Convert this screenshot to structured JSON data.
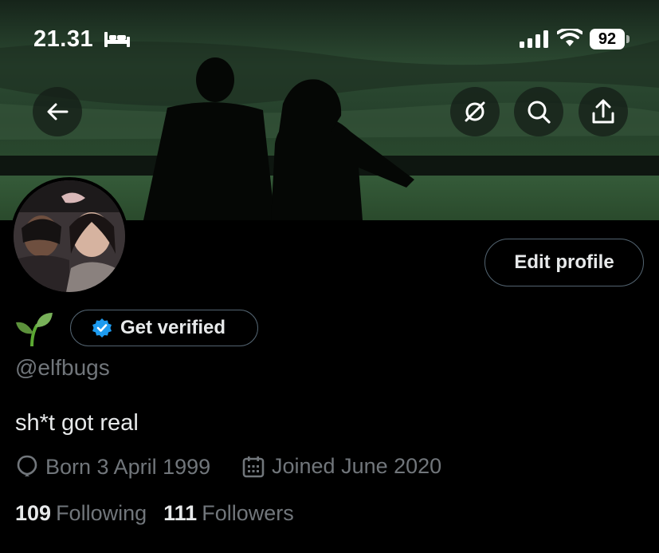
{
  "status_bar": {
    "time": "21.31",
    "battery": "92"
  },
  "header": {
    "back_icon": "arrow-left-icon",
    "actions": [
      "grok-icon",
      "search-icon",
      "share-icon"
    ]
  },
  "profile": {
    "display_name_emoji": "🌱",
    "verify_label": "Get verified",
    "edit_label": "Edit profile",
    "handle": "@elfbugs",
    "bio": "sh*t got real",
    "birth": "Born 3 April 1999",
    "joined": "Joined June 2020",
    "following_count": "109",
    "following_label": "Following",
    "followers_count": "111",
    "followers_label": "Followers"
  },
  "colors": {
    "background": "#000000",
    "muted_text": "#71767b",
    "verified_blue": "#1d9bf0",
    "border": "#536471"
  }
}
